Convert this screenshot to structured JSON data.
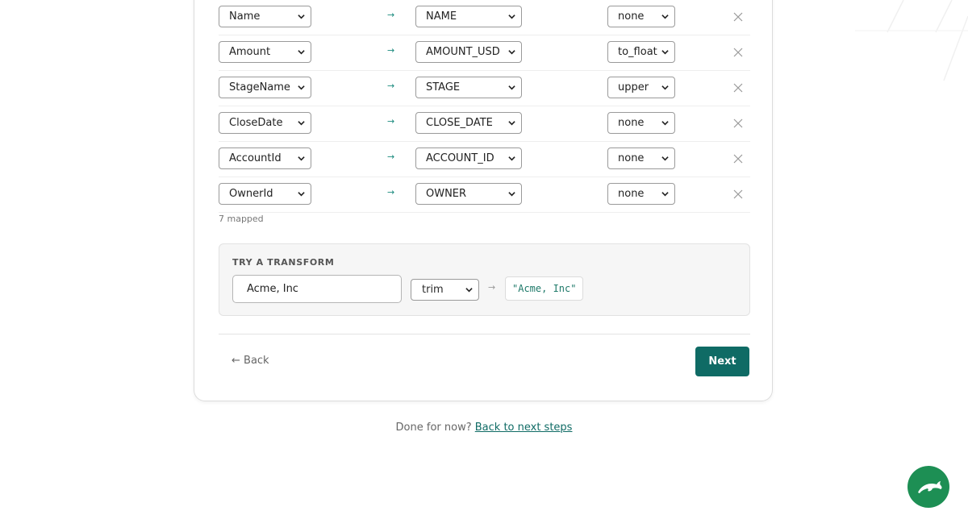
{
  "mappings": [
    {
      "source": "Name",
      "target": "NAME",
      "transform": "none"
    },
    {
      "source": "Amount",
      "target": "AMOUNT_USD",
      "transform": "to_float"
    },
    {
      "source": "StageName",
      "target": "STAGE",
      "transform": "upper"
    },
    {
      "source": "CloseDate",
      "target": "CLOSE_DATE",
      "transform": "none"
    },
    {
      "source": "AccountId",
      "target": "ACCOUNT_ID",
      "transform": "none"
    },
    {
      "source": "OwnerId",
      "target": "OWNER",
      "transform": "none"
    }
  ],
  "arrow_glyph": "→",
  "remove_glyph": "✕",
  "mapped_count_text": "7 mapped",
  "try_transform": {
    "title": "TRY A TRANSFORM",
    "input_value": "Acme, Inc",
    "transform": "trim",
    "arrow": "→",
    "output": "\"Acme, Inc\""
  },
  "nav": {
    "back_label": "← Back",
    "next_label": "Next"
  },
  "footer": {
    "text": "Done for now?",
    "link": "Back to next steps"
  },
  "colors": {
    "accent": "#0f6b65",
    "fab": "#1d8f54"
  },
  "icons": {
    "fab": "dolphin-icon"
  }
}
